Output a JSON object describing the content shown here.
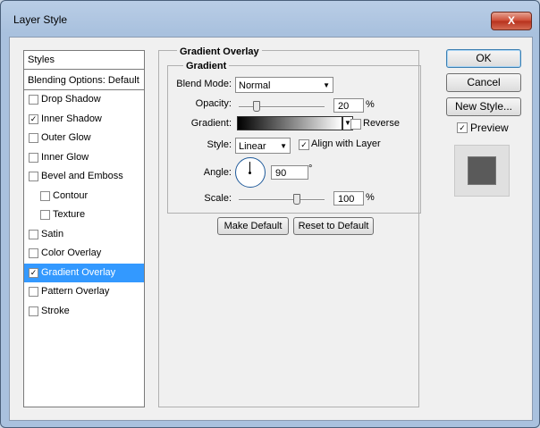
{
  "window": {
    "title": "Layer Style",
    "close_glyph": "X"
  },
  "styles_panel": {
    "header": "Styles",
    "blending_options": "Blending Options: Default",
    "items": [
      {
        "label": "Drop Shadow",
        "checked": false
      },
      {
        "label": "Inner Shadow",
        "checked": true
      },
      {
        "label": "Outer Glow",
        "checked": false
      },
      {
        "label": "Inner Glow",
        "checked": false
      },
      {
        "label": "Bevel and Emboss",
        "checked": false
      },
      {
        "label": "Contour",
        "checked": false,
        "sub": true
      },
      {
        "label": "Texture",
        "checked": false,
        "sub": true
      },
      {
        "label": "Satin",
        "checked": false
      },
      {
        "label": "Color Overlay",
        "checked": false
      },
      {
        "label": "Gradient Overlay",
        "checked": true,
        "selected": true
      },
      {
        "label": "Pattern Overlay",
        "checked": false
      },
      {
        "label": "Stroke",
        "checked": false
      }
    ]
  },
  "gradient_overlay": {
    "group_title": "Gradient Overlay",
    "sub_title": "Gradient",
    "blend_mode_label": "Blend Mode:",
    "blend_mode_value": "Normal",
    "opacity_label": "Opacity:",
    "opacity_value": "20",
    "opacity_unit": "%",
    "opacity_percent": 20,
    "gradient_label": "Gradient:",
    "reverse_label": "Reverse",
    "reverse_checked": false,
    "style_label": "Style:",
    "style_value": "Linear",
    "align_label": "Align with Layer",
    "align_checked": true,
    "angle_label": "Angle:",
    "angle_value": "90",
    "angle_unit": "°",
    "scale_label": "Scale:",
    "scale_value": "100",
    "scale_unit": "%",
    "scale_percent": 100,
    "make_default": "Make Default",
    "reset_default": "Reset to Default"
  },
  "buttons": {
    "ok": "OK",
    "cancel": "Cancel",
    "new_style": "New Style...",
    "preview_label": "Preview",
    "preview_checked": true
  },
  "check_glyph": "✓",
  "arrow_glyph": "▼"
}
